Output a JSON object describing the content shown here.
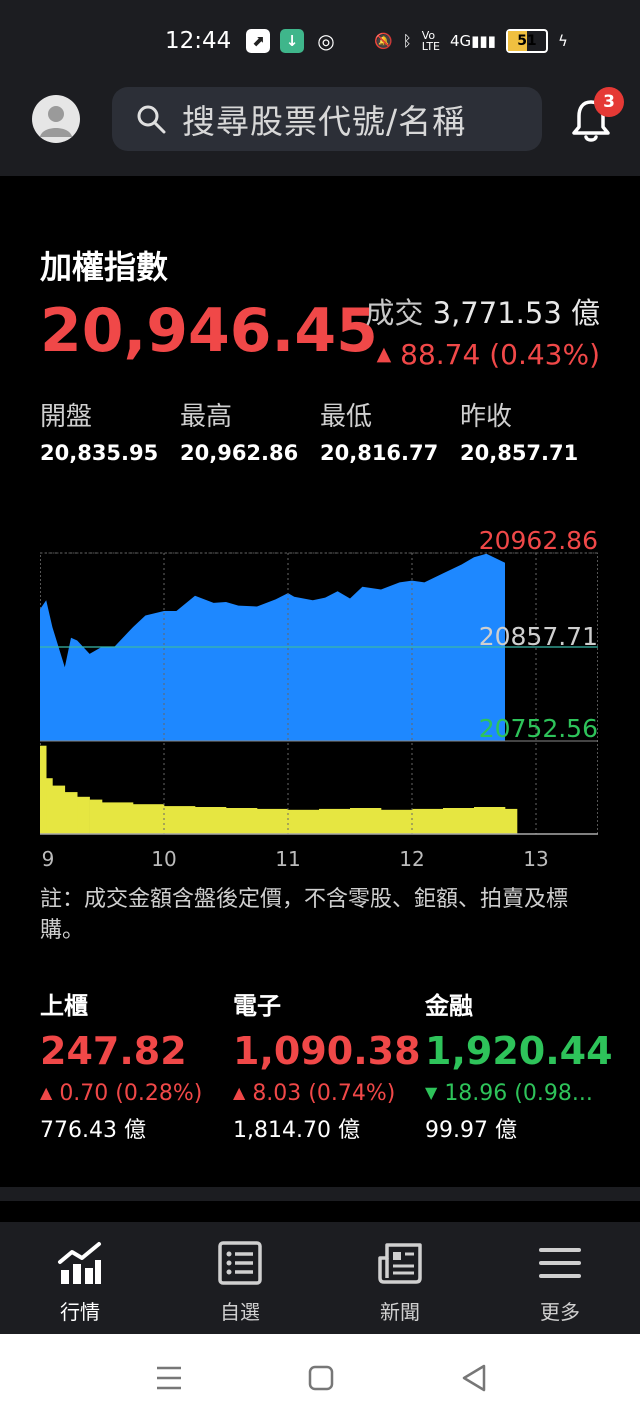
{
  "status": {
    "time": "12:44",
    "battery": "51",
    "network": "4G"
  },
  "search": {
    "placeholder": "搜尋股票代號/名稱"
  },
  "notifications": {
    "count": "3"
  },
  "index": {
    "title": "加權指數",
    "value": "20,946.45",
    "volume_label": "成交",
    "volume_value": "3,771.53 億",
    "change_arrow": "▲",
    "change": "88.74 (0.43%)"
  },
  "ohlc": [
    {
      "label": "開盤",
      "value": "20,835.95"
    },
    {
      "label": "最高",
      "value": "20,962.86"
    },
    {
      "label": "最低",
      "value": "20,816.77"
    },
    {
      "label": "昨收",
      "value": "20,857.71"
    }
  ],
  "colors": {
    "up": "#f04848",
    "down": "#2ec35a",
    "area": "#1e88ff",
    "volume": "#e6e641"
  },
  "chart_data": {
    "type": "area",
    "x_ticks": [
      "9",
      "10",
      "11",
      "12",
      "13"
    ],
    "y_labels": {
      "high": "20962.86",
      "prev_close": "20857.71",
      "low": "20752.56"
    },
    "ylim": [
      20752.56,
      20962.86
    ],
    "prev_close": 20857.71,
    "x": [
      9.0,
      9.05,
      9.1,
      9.2,
      9.25,
      9.3,
      9.4,
      9.5,
      9.6,
      9.75,
      9.85,
      10.0,
      10.1,
      10.25,
      10.4,
      10.5,
      10.6,
      10.75,
      10.9,
      11.0,
      11.05,
      11.2,
      11.3,
      11.4,
      11.5,
      11.6,
      11.75,
      11.9,
      12.0,
      12.1,
      12.25,
      12.4,
      12.5,
      12.6,
      12.75
    ],
    "series": [
      {
        "values": [
          20900,
          20910,
          20880,
          20835,
          20868,
          20865,
          20850,
          20858,
          20858,
          20880,
          20893,
          20898,
          20898,
          20915,
          20907,
          20908,
          20904,
          20903,
          20911,
          20918,
          20914,
          20910,
          20913,
          20920,
          20912,
          20925,
          20922,
          20930,
          20932,
          20930,
          20940,
          20950,
          20958,
          20962,
          20952
        ]
      }
    ],
    "volume": {
      "x": [
        9.0,
        9.05,
        9.1,
        9.2,
        9.3,
        9.4,
        9.5,
        9.75,
        10.0,
        10.25,
        10.5,
        10.75,
        11.0,
        11.25,
        11.5,
        11.75,
        12.0,
        12.25,
        12.5,
        12.75
      ],
      "values": [
        95,
        60,
        52,
        45,
        40,
        37,
        34,
        32,
        30,
        29,
        28,
        27,
        26,
        27,
        28,
        26,
        27,
        28,
        29,
        27
      ],
      "ymax": 100
    }
  },
  "note": "註：成交金額含盤後定價，不含零股、鉅額、拍賣及標購。",
  "sub_indices": [
    {
      "name": "上櫃",
      "value": "247.82",
      "arrow": "▲",
      "change": "0.70 (0.28%)",
      "volume": "776.43 億",
      "dir": "up"
    },
    {
      "name": "電子",
      "value": "1,090.38",
      "arrow": "▲",
      "change": "8.03 (0.74%)",
      "volume": "1,814.70 億",
      "dir": "up"
    },
    {
      "name": "金融",
      "value": "1,920.44",
      "arrow": "▼",
      "change": "18.96 (0.98...",
      "volume": "99.97 億",
      "dir": "down"
    }
  ],
  "nav": [
    {
      "label": "行情",
      "icon": "market-chart-icon",
      "active": true
    },
    {
      "label": "自選",
      "icon": "watchlist-icon",
      "active": false
    },
    {
      "label": "新聞",
      "icon": "news-icon",
      "active": false
    },
    {
      "label": "更多",
      "icon": "menu-icon",
      "active": false
    }
  ]
}
